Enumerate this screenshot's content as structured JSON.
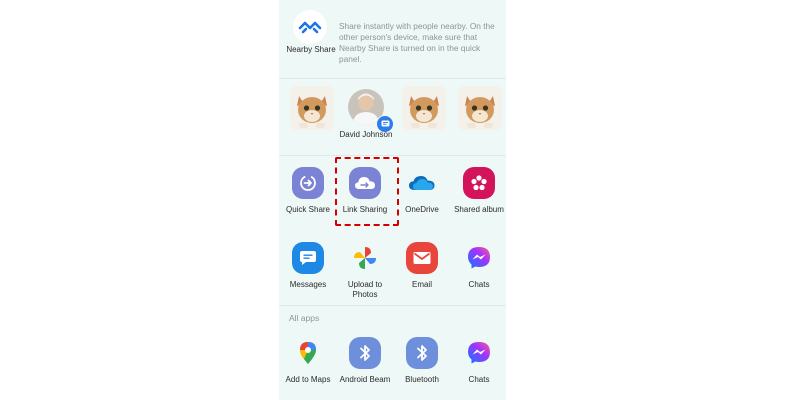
{
  "nearby_share": {
    "label": "Nearby Share",
    "description": "Share instantly with people nearby. On the other person's device, make sure that Nearby Share is turned on in the quick panel.",
    "icon": "nearby-share-icon"
  },
  "contacts": [
    {
      "name": "",
      "avatar": "cat-photo"
    },
    {
      "name": "David Johnson",
      "avatar": "person-photo",
      "badge_icon": "messages-icon"
    },
    {
      "name": "",
      "avatar": "cat-photo"
    },
    {
      "name": "",
      "avatar": "cat-photo"
    }
  ],
  "apps_row1": [
    {
      "label": "Quick Share",
      "icon": "quick-share-icon",
      "color": "#7b83d4"
    },
    {
      "label": "Link Sharing",
      "icon": "link-sharing-cloud-icon",
      "color": "#7b83d4"
    },
    {
      "label": "OneDrive",
      "icon": "onedrive-icon",
      "color": "#0f6cbd"
    },
    {
      "label": "Shared album",
      "icon": "shared-album-flower-icon",
      "color": "#d4145a"
    }
  ],
  "apps_row2": [
    {
      "label": "Messages",
      "icon": "messages-icon",
      "color": "#1e88e5"
    },
    {
      "label": "Upload to Photos",
      "icon": "google-photos-icon",
      "color": "#ffffff"
    },
    {
      "label": "Email",
      "icon": "email-icon",
      "color": "#e8453c"
    },
    {
      "label": "Chats",
      "icon": "messenger-icon",
      "color": "#a34cf0"
    }
  ],
  "all_apps": {
    "title": "All apps",
    "items": [
      {
        "label": "Add to Maps",
        "icon": "google-maps-icon",
        "color": "#ffffff"
      },
      {
        "label": "Android Beam",
        "icon": "bluetooth-icon",
        "color": "#6e8fdc"
      },
      {
        "label": "Bluetooth",
        "icon": "bluetooth-icon",
        "color": "#6e8fdc"
      },
      {
        "label": "Chats",
        "icon": "messenger-icon",
        "color": "#a34cf0"
      }
    ]
  },
  "highlight": {
    "target": "Link Sharing",
    "color": "#d40000"
  }
}
